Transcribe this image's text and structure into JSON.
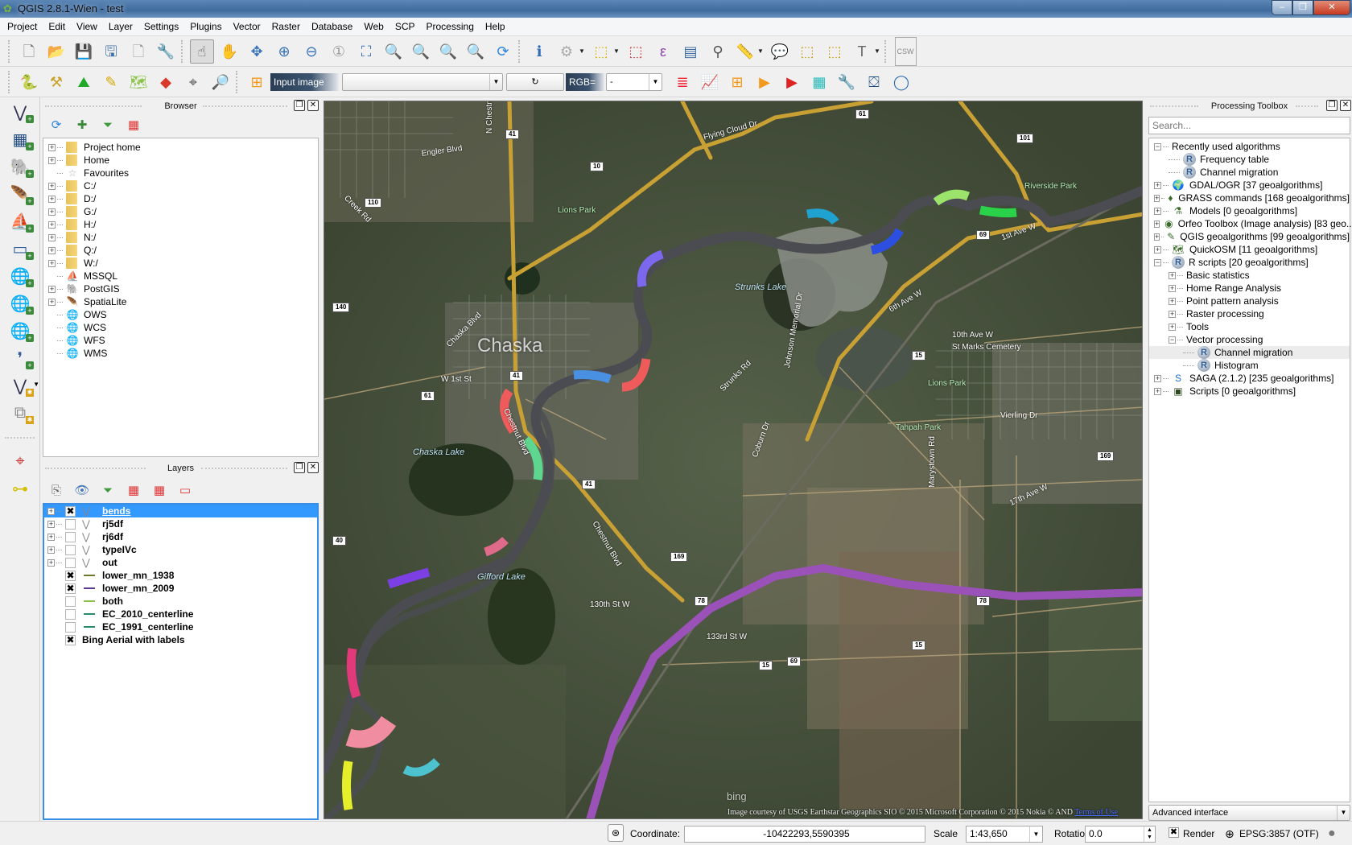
{
  "window": {
    "title": "QGIS 2.8.1-Wien - test",
    "controls": {
      "minimize": "–",
      "restore": "❐",
      "close": "✕"
    }
  },
  "menu": [
    "Project",
    "Edit",
    "View",
    "Layer",
    "Settings",
    "Plugins",
    "Vector",
    "Raster",
    "Database",
    "Web",
    "SCP",
    "Processing",
    "Help"
  ],
  "toolbar1": {
    "icons": [
      {
        "name": "new-project-icon",
        "glyph": "🗋",
        "color": "#777"
      },
      {
        "name": "open-project-icon",
        "glyph": "📂",
        "color": "#e0a820"
      },
      {
        "name": "save-project-icon",
        "glyph": "💾",
        "color": "#3f6fa5"
      },
      {
        "name": "save-as-icon",
        "glyph": "🖫",
        "color": "#3f6fa5"
      },
      {
        "name": "new-print-composer-icon",
        "glyph": "🗋",
        "color": "#999"
      },
      {
        "name": "composer-manager-icon",
        "glyph": "🔧",
        "color": "#888"
      },
      {
        "name": "touch-zoom-pan-icon",
        "glyph": "☝",
        "color": "#555",
        "active": true
      },
      {
        "name": "pan-map-icon",
        "glyph": "✋",
        "color": "#333"
      },
      {
        "name": "pan-to-selection-icon",
        "glyph": "✥",
        "color": "#3a73b9"
      },
      {
        "name": "zoom-in-icon",
        "glyph": "⊕",
        "color": "#3a73b9"
      },
      {
        "name": "zoom-out-icon",
        "glyph": "⊖",
        "color": "#3a73b9"
      },
      {
        "name": "zoom-native-icon",
        "glyph": "①",
        "color": "#999"
      },
      {
        "name": "zoom-full-icon",
        "glyph": "⛶",
        "color": "#3a73b9"
      },
      {
        "name": "zoom-to-selection-icon",
        "glyph": "🔍",
        "color": "#d4b300"
      },
      {
        "name": "zoom-to-layer-icon",
        "glyph": "🔍",
        "color": "#777"
      },
      {
        "name": "zoom-last-icon",
        "glyph": "🔍",
        "color": "#3a73b9"
      },
      {
        "name": "zoom-next-icon",
        "glyph": "🔍",
        "color": "#999"
      },
      {
        "name": "refresh-icon",
        "glyph": "⟳",
        "color": "#2e86de"
      },
      {
        "name": "identify-features-icon",
        "glyph": "ℹ",
        "color": "#2d6bb5"
      },
      {
        "name": "run-feature-action-icon",
        "glyph": "⚙",
        "color": "#aaa",
        "dropdown": true
      },
      {
        "name": "select-features-icon",
        "glyph": "⬚",
        "color": "#d4b300",
        "dropdown": true
      },
      {
        "name": "deselect-all-icon",
        "glyph": "⬚",
        "color": "#d33"
      },
      {
        "name": "select-by-expression-icon",
        "glyph": "ε",
        "color": "#8e44ad"
      },
      {
        "name": "attribute-table-icon",
        "glyph": "▤",
        "color": "#3f6fa5"
      },
      {
        "name": "field-calculator-icon",
        "glyph": "⚲",
        "color": "#555"
      },
      {
        "name": "measure-line-icon",
        "glyph": "📏",
        "color": "#555",
        "dropdown": true
      },
      {
        "name": "map-tips-icon",
        "glyph": "💬",
        "color": "#e0c020"
      },
      {
        "name": "new-bookmark-icon",
        "glyph": "⬚",
        "color": "#c79a16"
      },
      {
        "name": "show-bookmarks-icon",
        "glyph": "⬚",
        "color": "#c79a16"
      },
      {
        "name": "text-annotation-icon",
        "glyph": "T",
        "color": "#666",
        "dropdown": true
      },
      {
        "name": "csw-icon",
        "glyph": "CSW",
        "color": "#888"
      }
    ]
  },
  "toolbar2": {
    "icons_left": [
      {
        "name": "python-console-icon",
        "glyph": "🐍",
        "color": "#3776ab"
      },
      {
        "name": "hammer-icon",
        "glyph": "⚒",
        "color": "#c9a227"
      },
      {
        "name": "terrain-icon",
        "glyph": "⛰",
        "color": "#1faa2a"
      },
      {
        "name": "georeferencer-icon",
        "glyph": "✎",
        "color": "#d4a800"
      },
      {
        "name": "topology-checker-icon",
        "glyph": "🗺",
        "color": "#8bc34a"
      },
      {
        "name": "heatmap-icon",
        "glyph": "◆",
        "color": "#d9382a"
      },
      {
        "name": "coordinate-capture-icon",
        "glyph": "⌖",
        "color": "#555"
      },
      {
        "name": "search-points-icon",
        "glyph": "🔎",
        "color": "#2c6fb3"
      }
    ],
    "scp_icon": {
      "name": "scp-roi-icon",
      "glyph": "⊞",
      "color": "#f29a1f"
    },
    "input_image_label": "Input image",
    "input_image_value": "",
    "refresh_label": "↻",
    "rgb_label": "RGB=",
    "rgb_value": "-",
    "icons_right": [
      {
        "name": "band-set-icon",
        "glyph": "≣",
        "color": "#e23"
      },
      {
        "name": "spectral-plot-icon",
        "glyph": "📈",
        "color": "#d22"
      },
      {
        "name": "roi-icon",
        "glyph": "⊞",
        "color": "#f29a1f"
      },
      {
        "name": "pre-processing-icon",
        "glyph": "▶",
        "color": "#f29a1f"
      },
      {
        "name": "post-processing-icon",
        "glyph": "▶",
        "color": "#d22"
      },
      {
        "name": "band-calc-icon",
        "glyph": "▦",
        "color": "#2bb"
      },
      {
        "name": "settings-wrench-icon",
        "glyph": "🔧",
        "color": "#7a7"
      },
      {
        "name": "presentation-icon",
        "glyph": "⛋",
        "color": "#1f4b80"
      },
      {
        "name": "help-ring-icon",
        "glyph": "◯",
        "color": "#2c6fb3"
      }
    ]
  },
  "left_tools": [
    {
      "name": "add-vector-layer-icon",
      "glyph": "⋁",
      "color": "#335",
      "badge": "plus"
    },
    {
      "name": "add-raster-layer-icon",
      "glyph": "▦",
      "color": "#1f4b80",
      "badge": "plus"
    },
    {
      "name": "add-postgis-layer-icon",
      "glyph": "🐘",
      "color": "#2f5f9c",
      "badge": "plus"
    },
    {
      "name": "add-spatialite-layer-icon",
      "glyph": "🪶",
      "color": "#2f5f9c",
      "badge": "plus"
    },
    {
      "name": "add-mssql-layer-icon",
      "glyph": "⛵",
      "color": "#2f5f9c",
      "badge": "plus"
    },
    {
      "name": "add-oracle-layer-icon",
      "glyph": "▭",
      "color": "#2f5f9c",
      "badge": "plus"
    },
    {
      "name": "add-wms-layer-icon",
      "glyph": "🌐",
      "color": "#2f5f9c",
      "badge": "plus"
    },
    {
      "name": "add-wcs-layer-icon",
      "glyph": "🌐",
      "color": "#1f3f6c",
      "badge": "plus"
    },
    {
      "name": "add-wfs-layer-icon",
      "glyph": "🌐",
      "color": "#5a7aa0",
      "badge": "plus"
    },
    {
      "name": "add-delimited-text-icon",
      "glyph": "❜",
      "color": "#2f5f9c",
      "badge": "plus"
    },
    {
      "name": "new-shapefile-icon",
      "glyph": "⋁",
      "color": "#335",
      "badge": "gear",
      "dropdown": true
    },
    {
      "name": "new-temporary-layer-icon",
      "glyph": "⧉",
      "color": "#888",
      "badge": "gear"
    },
    {
      "name": "crosshair-tool-icon",
      "glyph": "⌖",
      "color": "#c33"
    },
    {
      "name": "annotation-move-icon",
      "glyph": "⊶",
      "color": "#d4c000"
    }
  ],
  "browser": {
    "title": "Browser",
    "tools": [
      {
        "name": "refresh-icon",
        "glyph": "⟳",
        "color": "#2e86de"
      },
      {
        "name": "add-selected-layers-icon",
        "glyph": "✚",
        "color": "#3d8a3d"
      },
      {
        "name": "filter-icon",
        "glyph": "⏷",
        "color": "#3d9a3d"
      },
      {
        "name": "collapse-all-icon",
        "glyph": "▦",
        "color": "#d33"
      }
    ],
    "items": [
      {
        "label": "Project home",
        "icon": "folder",
        "expandable": true
      },
      {
        "label": "Home",
        "icon": "folder",
        "expandable": true
      },
      {
        "label": "Favourites",
        "icon": "star",
        "expandable": false
      },
      {
        "label": "C:/",
        "icon": "folder",
        "expandable": true
      },
      {
        "label": "D:/",
        "icon": "folder",
        "expandable": true
      },
      {
        "label": "G:/",
        "icon": "folder",
        "expandable": true
      },
      {
        "label": "H:/",
        "icon": "folder",
        "expandable": true
      },
      {
        "label": "N:/",
        "icon": "folder",
        "expandable": true
      },
      {
        "label": "Q:/",
        "icon": "folder",
        "expandable": true
      },
      {
        "label": "W:/",
        "icon": "folder",
        "expandable": true
      },
      {
        "label": "MSSQL",
        "icon": "mssql",
        "expandable": false
      },
      {
        "label": "PostGIS",
        "icon": "postgis",
        "expandable": true
      },
      {
        "label": "SpatiaLite",
        "icon": "spatialite",
        "expandable": true
      },
      {
        "label": "OWS",
        "icon": "globe",
        "expandable": false
      },
      {
        "label": "WCS",
        "icon": "globe-dark",
        "expandable": false
      },
      {
        "label": "WFS",
        "icon": "globe-vector",
        "expandable": false
      },
      {
        "label": "WMS",
        "icon": "globe",
        "expandable": false
      }
    ]
  },
  "layers": {
    "title": "Layers",
    "tools": [
      {
        "name": "open-layer-styling-icon",
        "glyph": "⎘",
        "color": "#666"
      },
      {
        "name": "manage-visibility-icon",
        "glyph": "👁",
        "color": "#4a7ab5"
      },
      {
        "name": "filter-legend-icon",
        "glyph": "⏷",
        "color": "#3d9a3d"
      },
      {
        "name": "expand-all-icon",
        "glyph": "▦",
        "color": "#d33"
      },
      {
        "name": "collapse-all-icon",
        "glyph": "▦",
        "color": "#d33"
      },
      {
        "name": "remove-layer-icon",
        "glyph": "▭",
        "color": "#d33"
      }
    ],
    "items": [
      {
        "label": "bends",
        "checked": true,
        "symbol": "vector",
        "expandable": true,
        "selected": true
      },
      {
        "label": "rj5df",
        "checked": false,
        "symbol": "vector",
        "expandable": true
      },
      {
        "label": "rj6df",
        "checked": false,
        "symbol": "vector",
        "expandable": true
      },
      {
        "label": "typeIVc",
        "checked": false,
        "symbol": "vector",
        "expandable": true
      },
      {
        "label": "out",
        "checked": false,
        "symbol": "vector",
        "expandable": true
      },
      {
        "label": "lower_mn_1938",
        "checked": true,
        "symbol": "line",
        "color": "#6b7a2a"
      },
      {
        "label": "lower_mn_2009",
        "checked": true,
        "symbol": "line",
        "color": "#5a3a8a"
      },
      {
        "label": "both",
        "checked": false,
        "symbol": "line",
        "color": "#8bc34a"
      },
      {
        "label": "EC_2010_centerline",
        "checked": false,
        "symbol": "line",
        "color": "#2a8a6a"
      },
      {
        "label": "EC_1991_centerline",
        "checked": false,
        "symbol": "line",
        "color": "#2a8a6a"
      },
      {
        "label": "Bing Aerial with labels",
        "checked": true,
        "symbol": "raster"
      }
    ]
  },
  "map": {
    "city_label": "Chaska",
    "labels": [
      {
        "text": "Engler Blvd",
        "kind": "road"
      },
      {
        "text": "Flying Cloud Dr",
        "kind": "road"
      },
      {
        "text": "Lions Park",
        "kind": "park"
      },
      {
        "text": "Riverside Park",
        "kind": "park"
      },
      {
        "text": "Strunks Lake",
        "kind": "water"
      },
      {
        "text": "Chaska Lake",
        "kind": "water"
      },
      {
        "text": "Gifford Lake",
        "kind": "water"
      },
      {
        "text": "Chestnut Blvd",
        "kind": "road"
      },
      {
        "text": "Chaska Blvd",
        "kind": "road"
      },
      {
        "text": "1st Ave W",
        "kind": "road"
      },
      {
        "text": "6th Ave W",
        "kind": "road"
      },
      {
        "text": "10th Ave W",
        "kind": "road"
      },
      {
        "text": "Strunks Rd",
        "kind": "road"
      },
      {
        "text": "Johnson Memorial Dr",
        "kind": "road"
      },
      {
        "text": "Lions Park",
        "kind": "park"
      },
      {
        "text": "Tahpah Park",
        "kind": "park"
      },
      {
        "text": "St Marks Cemetery",
        "kind": "road"
      },
      {
        "text": "Creek Rd",
        "kind": "road"
      },
      {
        "text": "W 1st St",
        "kind": "road"
      },
      {
        "text": "Coburn Dr",
        "kind": "road"
      },
      {
        "text": "Chestnut Blvd",
        "kind": "road"
      },
      {
        "text": "130th St W",
        "kind": "road"
      },
      {
        "text": "133rd St W",
        "kind": "road"
      },
      {
        "text": "17th Ave W",
        "kind": "road"
      },
      {
        "text": "Vierling Dr",
        "kind": "road"
      },
      {
        "text": "Marystown Rd",
        "kind": "road"
      },
      {
        "text": "N Chestnut St",
        "kind": "road"
      }
    ],
    "shields": [
      "61",
      "101",
      "41",
      "10",
      "110",
      "140",
      "41",
      "61",
      "15",
      "169",
      "41",
      "169",
      "78",
      "78",
      "15",
      "40",
      "69",
      "69",
      "15"
    ],
    "attribution": "Image courtesy of USGS Earthstar Geographics SIO © 2015 Microsoft Corporation © 2015 Nokia © AND",
    "attribution_link": "Terms of Use",
    "bing_logo": "bing"
  },
  "processing": {
    "title": "Processing Toolbox",
    "search_placeholder": "Search...",
    "items": [
      {
        "label": "Recently used algorithms",
        "level": 0,
        "expander": "−",
        "icon": ""
      },
      {
        "label": "Frequency table",
        "level": 1,
        "icon": "r"
      },
      {
        "label": "Channel migration",
        "level": 1,
        "icon": "r"
      },
      {
        "label": "GDAL/OGR [37 geoalgorithms]",
        "level": 0,
        "expander": "+",
        "icon": "gdal"
      },
      {
        "label": "GRASS commands [168 geoalgorithms]",
        "level": 0,
        "expander": "+",
        "icon": "grass"
      },
      {
        "label": "Models [0 geoalgorithms]",
        "level": 0,
        "expander": "+",
        "icon": "models"
      },
      {
        "label": "Orfeo Toolbox (Image analysis) [83 geo...",
        "level": 0,
        "expander": "+",
        "icon": "otb"
      },
      {
        "label": "QGIS geoalgorithms [99 geoalgorithms]",
        "level": 0,
        "expander": "+",
        "icon": "qgis"
      },
      {
        "label": "QuickOSM [11 geoalgorithms]",
        "level": 0,
        "expander": "+",
        "icon": "osm"
      },
      {
        "label": "R scripts [20 geoalgorithms]",
        "level": 0,
        "expander": "−",
        "icon": "r"
      },
      {
        "label": "Basic statistics",
        "level": 1,
        "expander": "+",
        "icon": ""
      },
      {
        "label": "Home Range Analysis",
        "level": 1,
        "expander": "+",
        "icon": ""
      },
      {
        "label": "Point pattern analysis",
        "level": 1,
        "expander": "+",
        "icon": ""
      },
      {
        "label": "Raster processing",
        "level": 1,
        "expander": "+",
        "icon": ""
      },
      {
        "label": "Tools",
        "level": 1,
        "expander": "+",
        "icon": ""
      },
      {
        "label": "Vector processing",
        "level": 1,
        "expander": "−",
        "icon": ""
      },
      {
        "label": "Channel migration",
        "level": 2,
        "icon": "r",
        "highlight": true
      },
      {
        "label": "Histogram",
        "level": 2,
        "icon": "r"
      },
      {
        "label": "SAGA (2.1.2) [235 geoalgorithms]",
        "level": 0,
        "expander": "+",
        "icon": "saga"
      },
      {
        "label": "Scripts [0 geoalgorithms]",
        "level": 0,
        "expander": "+",
        "icon": "scripts"
      }
    ],
    "interface_mode": "Advanced interface"
  },
  "statusbar": {
    "coordinate_label": "Coordinate:",
    "coordinate_value": "-10422293,5590395",
    "scale_label": "Scale",
    "scale_value": "1:43,650",
    "rotation_label": "Rotation:",
    "rotation_value": "0.0",
    "render_label": "Render",
    "render_checked": true,
    "crs_label": "EPSG:3857 (OTF)"
  }
}
